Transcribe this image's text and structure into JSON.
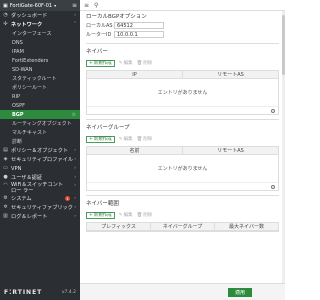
{
  "sidebar": {
    "device_name": "FortiGate-60F-01",
    "items": [
      {
        "label": "ダッシュボード",
        "icon": "dashboard-icon",
        "chevron": "›"
      },
      {
        "label": "ネットワーク",
        "icon": "network-icon",
        "chevron": "˅",
        "expanded": true
      }
    ],
    "network_subitems": [
      "インターフェース",
      "DNS",
      "IPAM",
      "FortiExtenders",
      "SD-WAN",
      "スタティックルート",
      "ポリシールート",
      "RIP",
      "OSPF",
      "BGP",
      "ルーティングオブジェクト",
      "マルチキャスト",
      "診断"
    ],
    "active_subitem": "BGP",
    "bottom_items": [
      {
        "label": "ポリシー＆オブジェクト",
        "icon": "policy-icon"
      },
      {
        "label": "セキュリティプロファイル",
        "icon": "shield-icon"
      },
      {
        "label": "VPN",
        "icon": "vpn-icon"
      },
      {
        "label": "ユーザ＆認証",
        "icon": "user-icon"
      },
      {
        "label": "WiFi＆スイッチコントロー ラー",
        "icon": "wifi-icon"
      },
      {
        "label": "システム",
        "icon": "gear-icon",
        "badge": "1"
      },
      {
        "label": "セキュリティファブリック",
        "icon": "fabric-icon"
      },
      {
        "label": "ログ＆レポート",
        "icon": "log-icon"
      }
    ],
    "logo": "F⁚RTINET",
    "version": "v7.4.2"
  },
  "main": {
    "local_options_title": "ローカルBGPオプション",
    "local_as_label": "ローカルAS",
    "local_as_value": "64512",
    "router_id_label": "ルーターID",
    "router_id_value": "10.0.0.1",
    "neighbor_title": "ネイバー",
    "neighbor_group_title": "ネイバーグループ",
    "neighbor_range_title": "ネイバー範囲",
    "create_new_label": "新規作成",
    "edit_label": "編集",
    "delete_label": "削除",
    "neighbor_columns": [
      "IP",
      "リモートAS"
    ],
    "neighbor_group_columns": [
      "名前",
      "リモートAS"
    ],
    "neighbor_range_columns": [
      "プレフィックス",
      "ネイバーグループ",
      "最大ネイバー数"
    ],
    "empty_text": "エントリがありません",
    "apply_label": "適用"
  }
}
